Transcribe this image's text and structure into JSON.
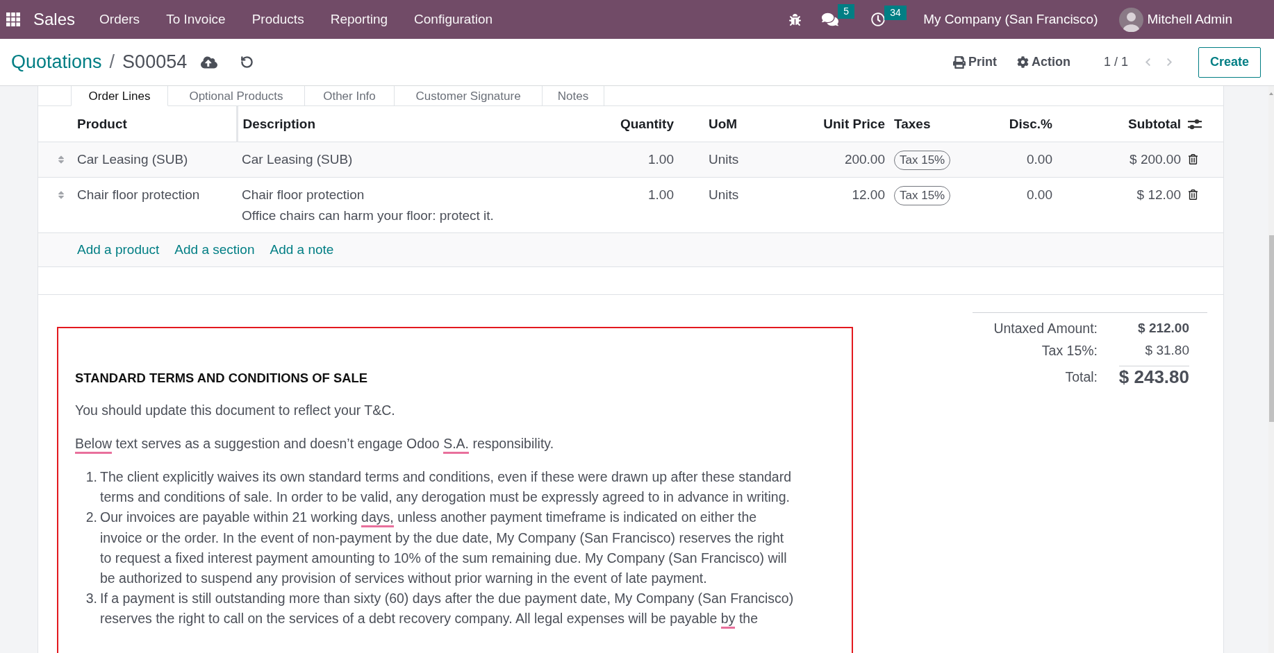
{
  "navbar": {
    "app_name": "Sales",
    "menu": [
      "Orders",
      "To Invoice",
      "Products",
      "Reporting",
      "Configuration"
    ],
    "messages_badge": "5",
    "activities_badge": "34",
    "company": "My Company (San Francisco)",
    "user": "Mitchell Admin"
  },
  "control_panel": {
    "breadcrumb": {
      "parent": "Quotations",
      "separator": "/",
      "current": "S00054"
    },
    "print": "Print",
    "action": "Action",
    "pager": {
      "value": "1 / 1",
      "previous_disabled": true,
      "next_disabled": true
    },
    "create": "Create"
  },
  "tabs": [
    {
      "label": "Order Lines",
      "selected": true
    },
    {
      "label": "Optional Products",
      "selected": false
    },
    {
      "label": "Other Info",
      "selected": false
    },
    {
      "label": "Customer Signature",
      "selected": false
    },
    {
      "label": "Notes",
      "selected": false
    }
  ],
  "order_lines": {
    "columns": [
      "Product",
      "Description",
      "Quantity",
      "UoM",
      "Unit Price",
      "Taxes",
      "Disc.%",
      "Subtotal"
    ],
    "rows": [
      {
        "product": "Car Leasing (SUB)",
        "description": "Car Leasing (SUB)",
        "quantity": "1.00",
        "uom": "Units",
        "unit_price": "200.00",
        "taxes": [
          "Tax 15%"
        ],
        "discount": "0.00",
        "subtotal": "$ 200.00"
      },
      {
        "product": "Chair floor protection",
        "description": "Chair floor protection\nOffice chairs can harm your floor: protect it.",
        "quantity": "1.00",
        "uom": "Units",
        "unit_price": "12.00",
        "taxes": [
          "Tax 15%"
        ],
        "discount": "0.00",
        "subtotal": "$ 12.00"
      }
    ],
    "add_links": [
      "Add a product",
      "Add a section",
      "Add a note"
    ]
  },
  "totals": [
    {
      "kind": "untaxed",
      "label": "Untaxed Amount:",
      "value": "$ 212.00"
    },
    {
      "kind": "tax",
      "label": "Tax 15%:",
      "value": "$ 31.80"
    },
    {
      "kind": "total",
      "label": "Total:",
      "value": "$ 243.80"
    }
  ],
  "terms": {
    "heading": "STANDARD TERMS AND CONDITIONS OF SALE",
    "paragraphs": [
      {
        "segments": [
          {
            "text": "You should update this document to reflect your T&C.",
            "spellcheck_error": false
          }
        ]
      },
      {
        "segments": [
          {
            "text": "Below",
            "spellcheck_error": true
          },
          {
            "text": " text serves as a suggestion and doesn’t engage Odoo ",
            "spellcheck_error": false
          },
          {
            "text": "S.A.",
            "spellcheck_error": true
          },
          {
            "text": " responsibility.",
            "spellcheck_error": false
          }
        ]
      }
    ],
    "list": [
      {
        "number": "1.",
        "segments": [
          {
            "text": "The client explicitly waives its own standard terms and conditions, even if these were drawn up after these standard terms and conditions of sale. In order to be valid, any derogation must be expressly agreed to in advance in writing.",
            "spellcheck_error": false
          }
        ]
      },
      {
        "number": "2.",
        "segments": [
          {
            "text": "Our invoices are payable within 21 working ",
            "spellcheck_error": false
          },
          {
            "text": "days,",
            "spellcheck_error": true
          },
          {
            "text": " unless another payment timeframe is indicated on either the invoice or the order. In the event of non-payment by the due date, My Company (San Francisco) reserves the right to request a fixed interest payment amounting to 10% of the sum remaining due. My Company (San Francisco) will be authorized to suspend any provision of services without prior warning in the event of late payment.",
            "spellcheck_error": false
          }
        ]
      },
      {
        "number": "3.",
        "segments": [
          {
            "text": "If a payment is still outstanding more than sixty (60) days after the due payment date, My Company (San Francisco) reserves the right to call on the services of a debt recovery company. All legal expenses will be payable ",
            "spellcheck_error": false
          },
          {
            "text": "by",
            "spellcheck_error": true
          },
          {
            "text": " the",
            "spellcheck_error": false
          }
        ]
      }
    ]
  }
}
